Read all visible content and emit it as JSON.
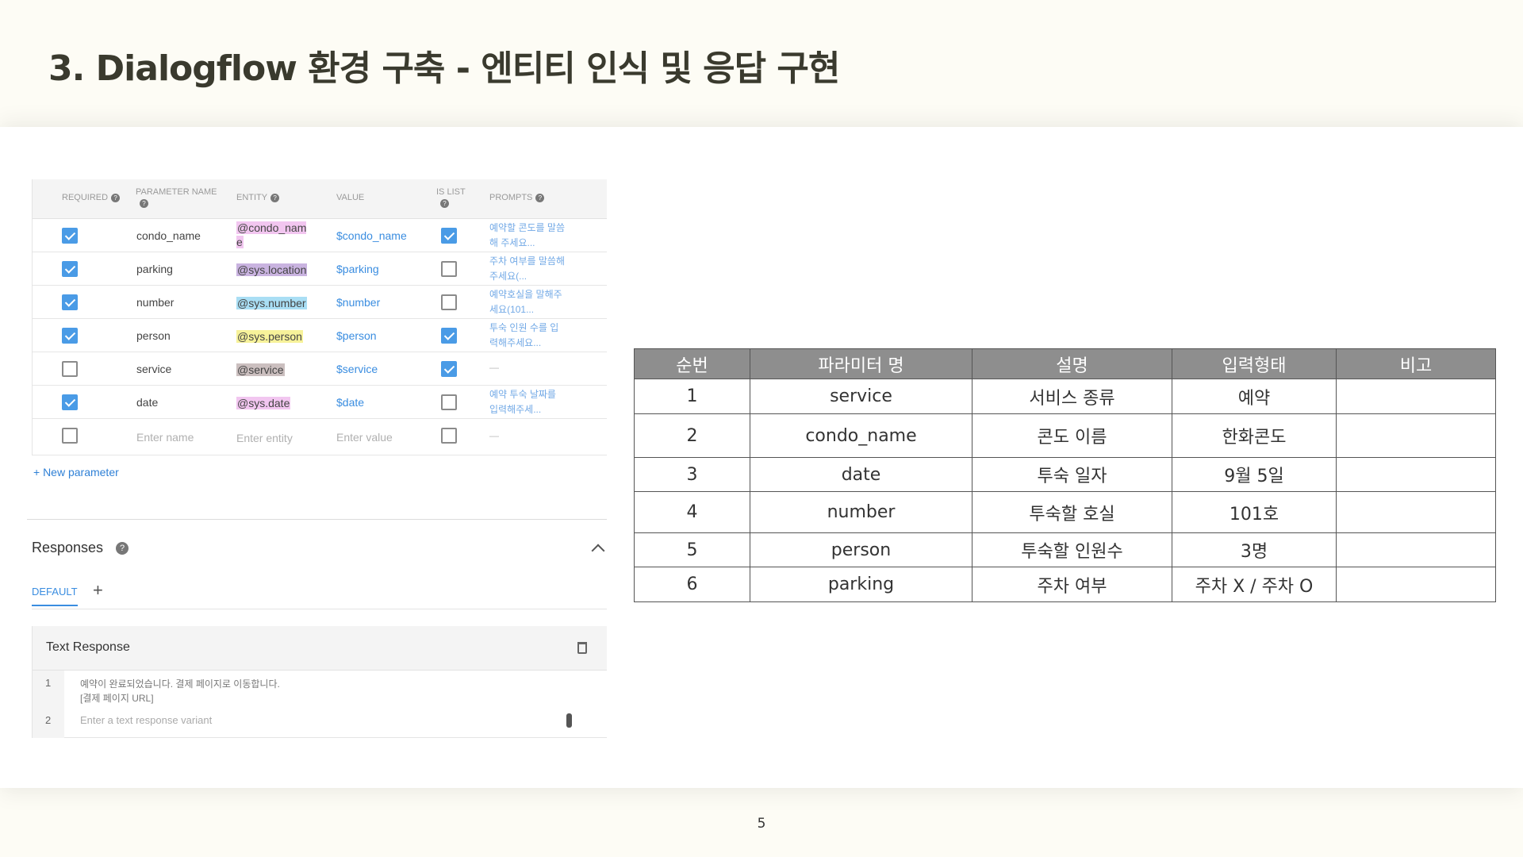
{
  "title": "3. Dialogflow 환경 구축 - 엔티티 인식 및 응답 구현",
  "page_number": "5",
  "dialogflow": {
    "headers": {
      "required": "REQUIRED",
      "parameter_name": "PARAMETER NAME",
      "entity": "ENTITY",
      "value": "VALUE",
      "is_list": "IS LIST",
      "prompts": "PROMPTS"
    },
    "rows": [
      {
        "required": true,
        "name": "condo_name",
        "entity": "@condo_name",
        "entity_color": "#f2c6f0",
        "value": "$condo_name",
        "is_list": true,
        "prompt": "예약할 콘도를 말씀해 주세요..."
      },
      {
        "required": true,
        "name": "parking",
        "entity": "@sys.location",
        "entity_color": "#c9b3e0",
        "value": "$parking",
        "is_list": false,
        "prompt": "주차 여부를 말씀해 주세요(..."
      },
      {
        "required": true,
        "name": "number",
        "entity": "@sys.number",
        "entity_color": "#a9def4",
        "value": "$number",
        "is_list": false,
        "prompt": "예약호실을 말해주세요(101..."
      },
      {
        "required": true,
        "name": "person",
        "entity": "@sys.person",
        "entity_color": "#f7f29a",
        "value": "$person",
        "is_list": true,
        "prompt": "투숙 인원 수를 입력해주세요..."
      },
      {
        "required": false,
        "name": "service",
        "entity": "@service",
        "entity_color": "#cbbfbf",
        "value": "$service",
        "is_list": true,
        "prompt": "—"
      },
      {
        "required": true,
        "name": "date",
        "entity": "@sys.date",
        "entity_color": "#f2c6f0",
        "value": "$date",
        "is_list": false,
        "prompt": "예약 투숙 날짜를 입력해주세..."
      }
    ],
    "new_row": {
      "name_placeholder": "Enter name",
      "entity_placeholder": "Enter entity",
      "value_placeholder": "Enter value",
      "prompt": "—"
    },
    "new_parameter": "+ New parameter",
    "responses_title": "Responses",
    "default_tab": "DEFAULT",
    "add_tab": "+",
    "text_response_title": "Text Response",
    "lines": [
      {
        "num": "1",
        "text_a": "예약이 완료되었습니다. 결제 페이지로 이동합니다.",
        "text_b": "[결제 페이지 URL]"
      },
      {
        "num": "2",
        "placeholder": "Enter a text response variant"
      }
    ]
  },
  "param_table": {
    "headers": [
      "순번",
      "파라미터 명",
      "설명",
      "입력형태",
      "비고"
    ],
    "rows": [
      [
        "1",
        "service",
        "서비스 종류",
        "예약",
        ""
      ],
      [
        "2",
        "condo_name",
        "콘도 이름",
        "한화콘도",
        ""
      ],
      [
        "3",
        "date",
        "투숙 일자",
        "9월 5일",
        ""
      ],
      [
        "4",
        "number",
        "투숙할 호실",
        "101호",
        ""
      ],
      [
        "5",
        "person",
        "투숙할 인원수",
        "3명",
        ""
      ],
      [
        "6",
        "parking",
        "주차 여부",
        "주차 X / 주차 O",
        ""
      ]
    ]
  }
}
